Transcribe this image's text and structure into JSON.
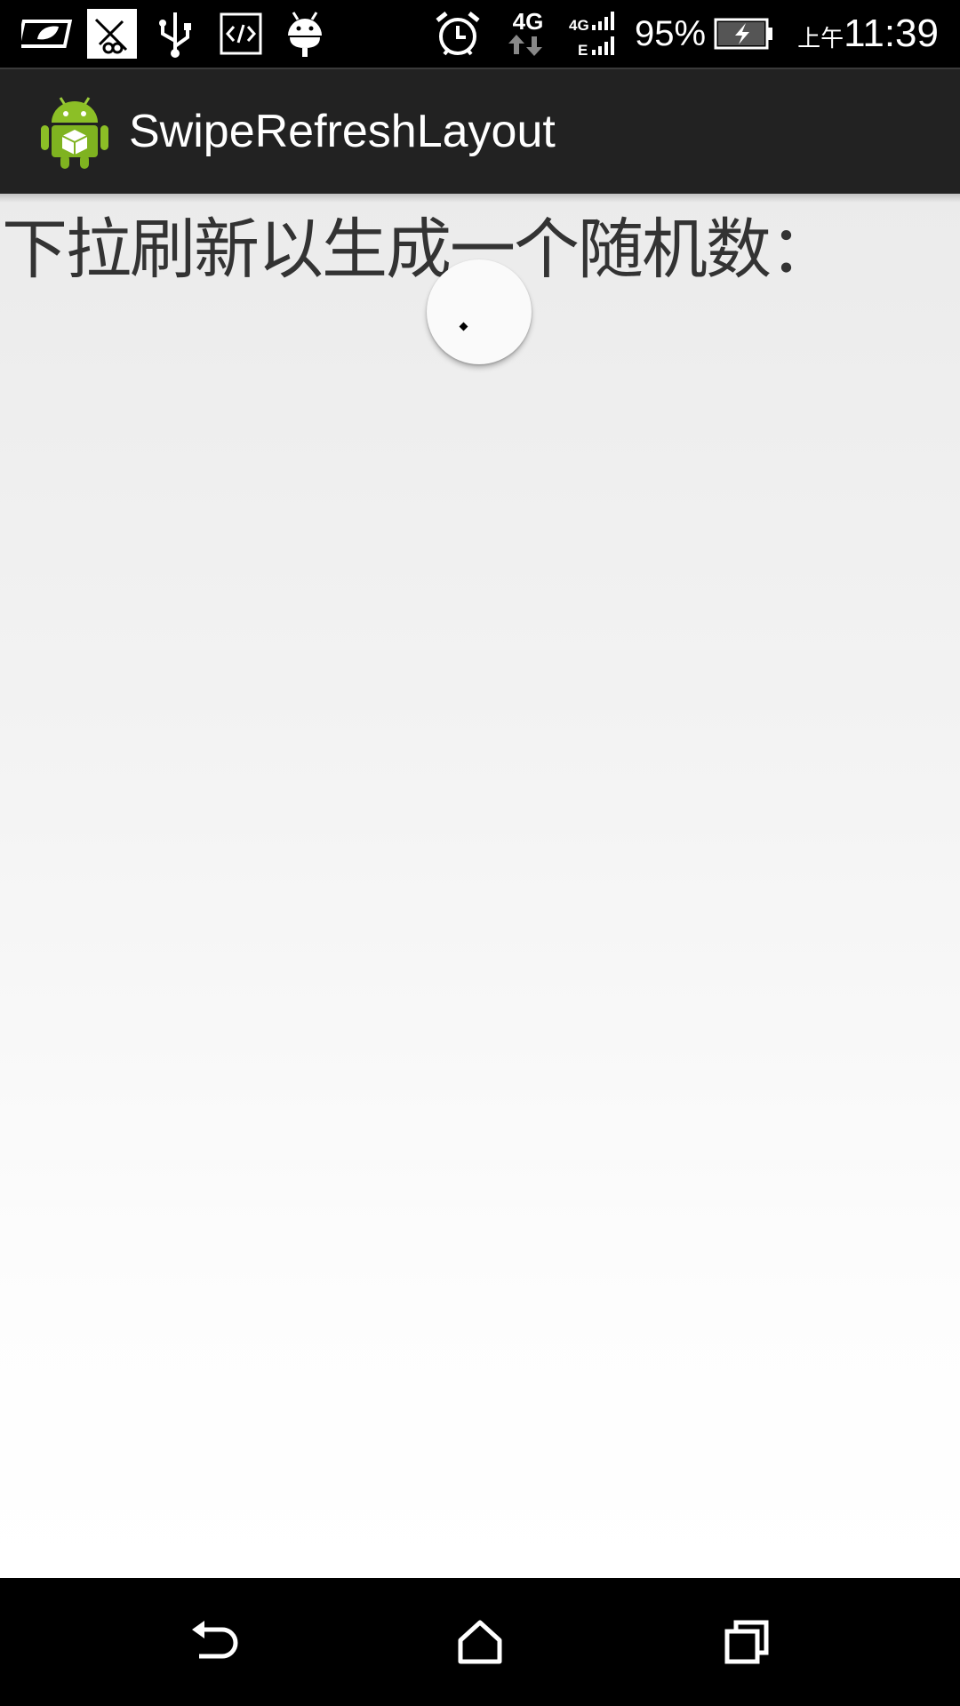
{
  "status_bar": {
    "icons_left": [
      "leaf-battery-icon",
      "evernote-notification-icon",
      "usb-icon",
      "developer-code-icon",
      "android-debug-icon"
    ],
    "icons_right": [
      "alarm-clock-icon",
      "network-4g-icon",
      "signal-strength-icon",
      "battery-charging-icon"
    ],
    "network_label": "4G",
    "battery_percent": "95%",
    "ampm": "上午",
    "time": "11:39"
  },
  "action_bar": {
    "app_icon": "android-app-icon",
    "title": "SwipeRefreshLayout"
  },
  "content": {
    "prompt_text": "下拉刷新以生成一个随机数："
  },
  "refresh_indicator": {
    "icon": "refresh-spinner-icon"
  },
  "nav_bar": {
    "buttons": [
      "back-icon",
      "home-icon",
      "recents-icon"
    ]
  },
  "colors": {
    "action_bar_bg": "#222222",
    "content_bg_top": "#ebebeb",
    "content_bg_bottom": "#ffffff",
    "text_color": "#333333"
  }
}
